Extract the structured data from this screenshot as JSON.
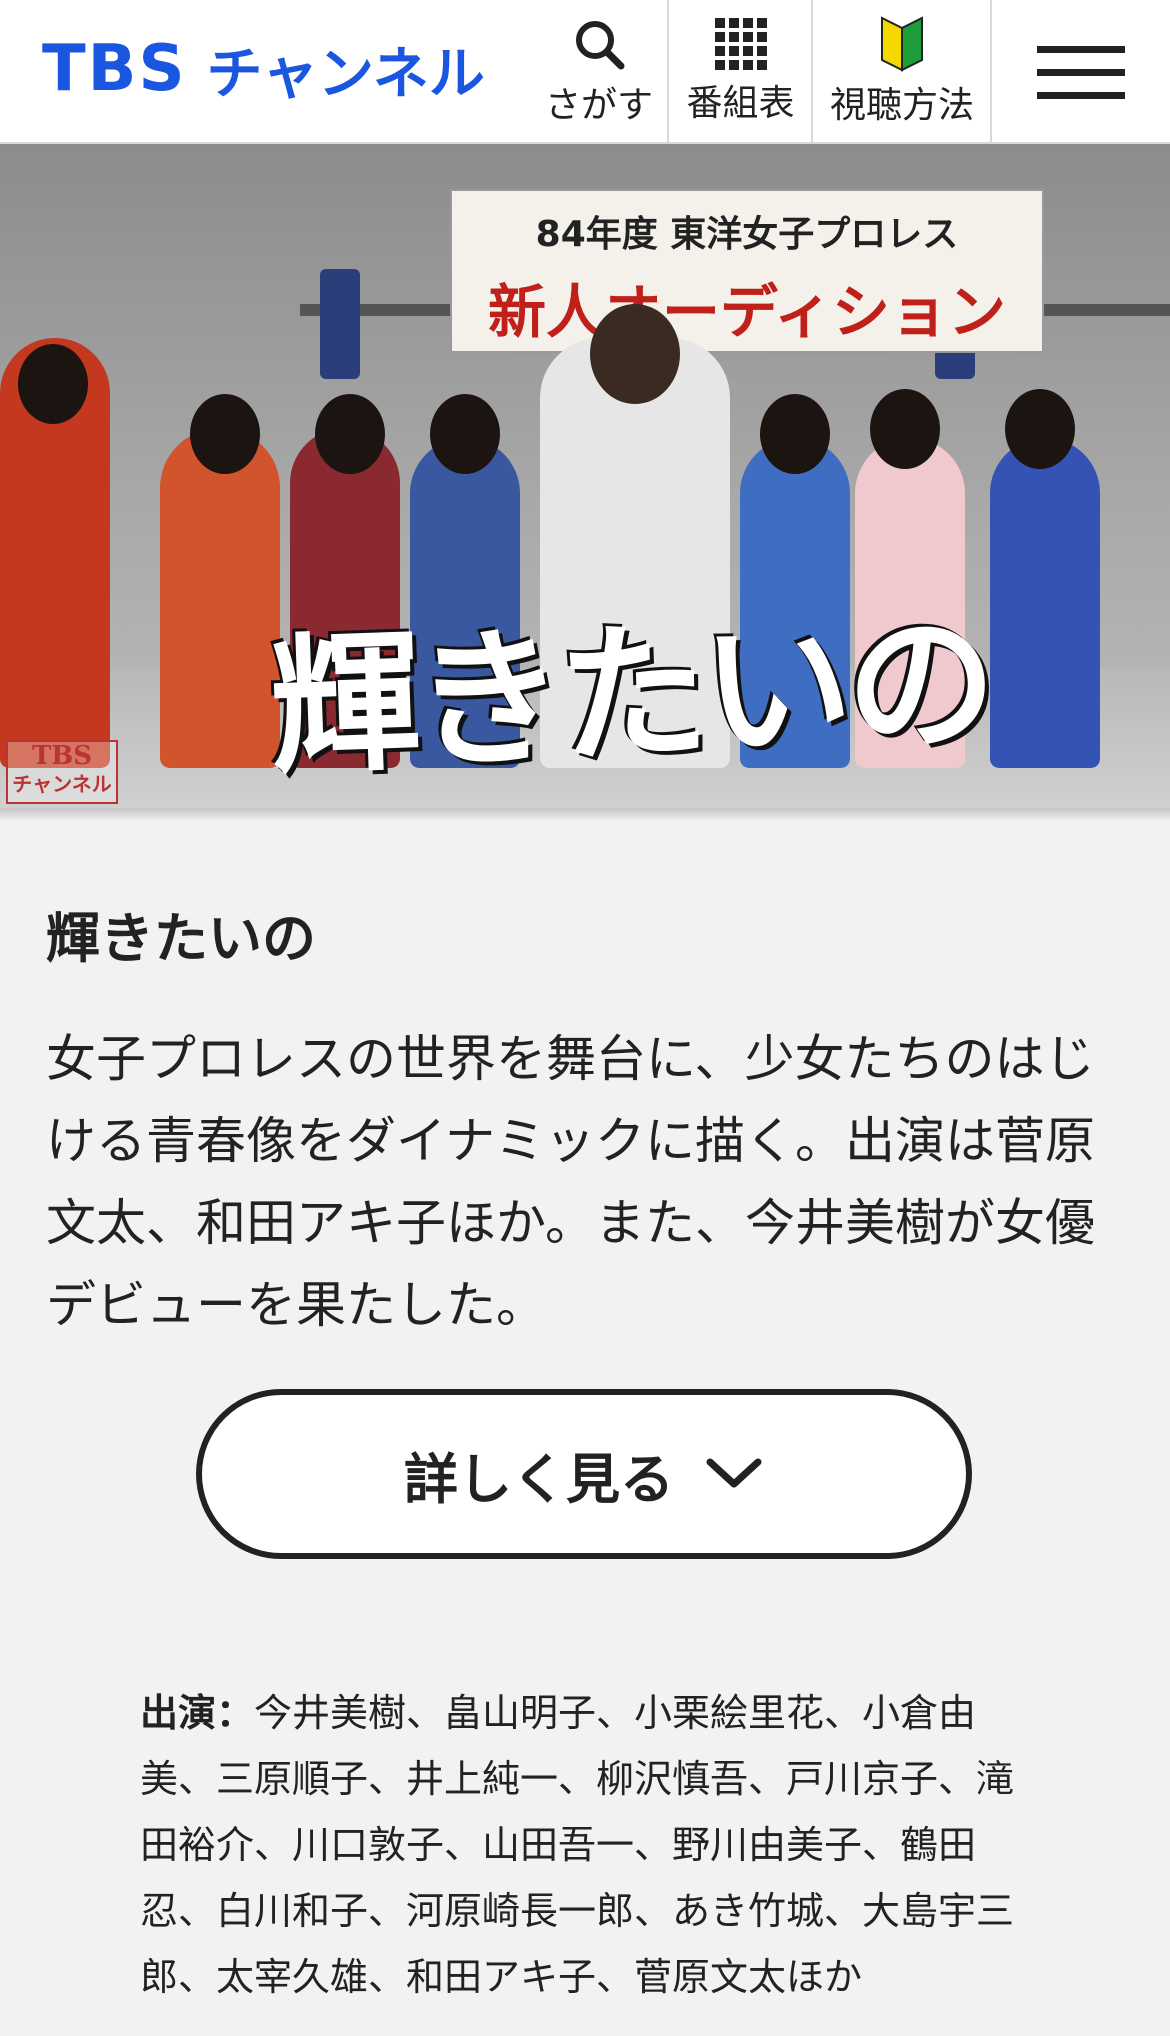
{
  "header": {
    "logo_main": "TBS",
    "logo_sub": "チャンネル",
    "nav": {
      "search_label": "さがす",
      "guide_label": "番組表",
      "how_label": "視聴方法"
    }
  },
  "hero": {
    "banner_line1": "84年度 東洋女子プロレス",
    "banner_line2": "新人オーディション",
    "overlay_title": "輝きたいの",
    "watermark_top": "TBS",
    "watermark_bottom": "チャンネル"
  },
  "program": {
    "title": "輝きたいの",
    "description": "女子プロレスの世界を舞台に、少女たちのはじける青春像をダイナミックに描く。出演は菅原文太、和田アキ子ほか。また、今井美樹が女優デビューを果たした。",
    "more_label": "詳しく見る",
    "cast_label": "出演：",
    "cast_text": "今井美樹、畠山明子、小栗絵里花、小倉由美、三原順子、井上純一、柳沢慎吾、戸川京子、滝田裕介、川口敦子、山田吾一、野川由美子、鶴田忍、白川和子、河原崎長一郎、あき竹城、大島宇三郎、太宰久雄、和田アキ子、菅原文太ほか"
  },
  "colors": {
    "brand_blue": "#1a56e0",
    "banner_red": "#c0201a"
  }
}
